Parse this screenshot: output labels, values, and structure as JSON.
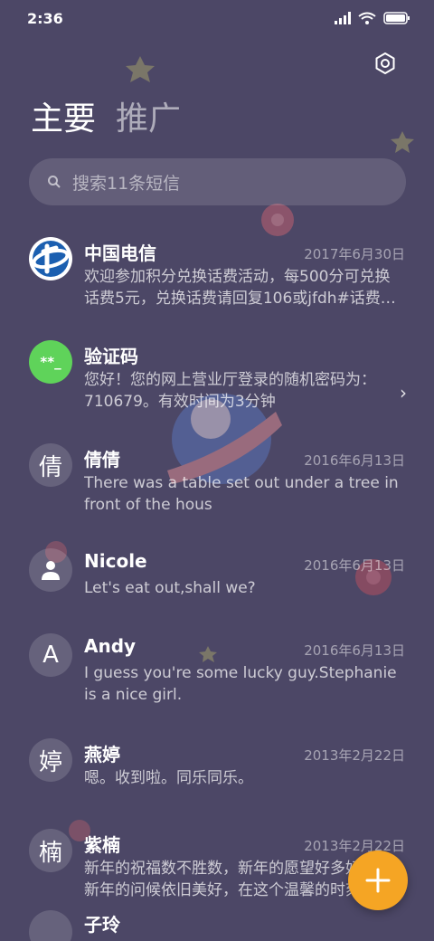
{
  "status_bar": {
    "time": "2:36"
  },
  "tabs": [
    {
      "label": "主要",
      "active": true
    },
    {
      "label": "推广",
      "active": false
    }
  ],
  "search": {
    "placeholder": "搜索11条短信"
  },
  "conversations": [
    {
      "name": "中国电信",
      "date": "2017年6月30日",
      "preview": "欢迎参加积分兑换话费活动，每500分可兑换话费5元，兑换话费请回复106或jfdh#话费…",
      "avatar": "telecom-logo"
    },
    {
      "name": "验证码",
      "date": "",
      "preview": "您好！您的网上营业厅登录的随机密码为：710679。有效时间为3分钟",
      "avatar": "**_",
      "avatar_color": "#5fd35a",
      "has_chevron": true
    },
    {
      "name": "倩倩",
      "date": "2016年6月13日",
      "preview": "There was a table set out under a tree in front of the hous",
      "avatar": "倩"
    },
    {
      "name": "Nicole",
      "date": "2016年6月13日",
      "preview": "Let's eat out,shall we?",
      "avatar": "person-icon"
    },
    {
      "name": "Andy",
      "date": "2016年6月13日",
      "preview": "I guess you're some lucky guy.Stephanie is a nice girl.",
      "avatar": "A"
    },
    {
      "name": "燕婷",
      "date": "2013年2月22日",
      "preview": "嗯。收到啦。同乐同乐。",
      "avatar": "婷"
    },
    {
      "name": "紫楠",
      "date": "2013年2月22日",
      "preview": "新年的祝福数不胜数，新年的愿望好多好多，新年的问候依旧美好，在这个温馨的时刻",
      "avatar": "楠"
    },
    {
      "name": "子玲",
      "date": "",
      "preview": "",
      "avatar": ""
    }
  ],
  "colors": {
    "background": "#4c4766",
    "fab": "#f5a524",
    "verify_avatar": "#5fd35a",
    "telecom_blue": "#1b5fb0"
  }
}
